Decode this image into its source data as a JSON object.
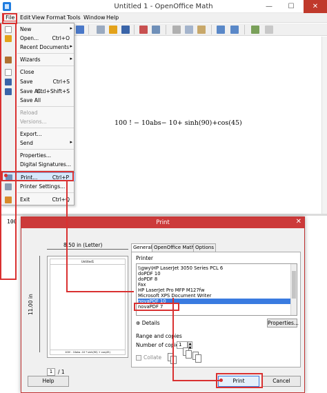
{
  "window": {
    "title": "Untitled 1 - OpenOffice Math",
    "minimize": "—",
    "maximize": "☐",
    "close": "✕"
  },
  "menubar": {
    "items": [
      "File",
      "Edit",
      "View",
      "Format",
      "Tools",
      "Window",
      "Help"
    ]
  },
  "file_menu": {
    "items": [
      {
        "label": "New",
        "shortcut": "",
        "submenu": true
      },
      {
        "label": "Open...",
        "shortcut": "Ctrl+O"
      },
      {
        "label": "Recent Documents",
        "shortcut": "",
        "submenu": true
      },
      {
        "label": "Wizards",
        "shortcut": "",
        "submenu": true
      },
      {
        "label": "Close",
        "shortcut": ""
      },
      {
        "label": "Save",
        "shortcut": "Ctrl+S"
      },
      {
        "label": "Save As...",
        "shortcut": "Ctrl+Shift+S"
      },
      {
        "label": "Save All",
        "shortcut": ""
      },
      {
        "label": "Reload",
        "shortcut": "",
        "disabled": true
      },
      {
        "label": "Versions...",
        "shortcut": "",
        "disabled": true
      },
      {
        "label": "Export...",
        "shortcut": ""
      },
      {
        "label": "Send",
        "shortcut": "",
        "submenu": true
      },
      {
        "label": "Properties...",
        "shortcut": ""
      },
      {
        "label": "Digital Signatures...",
        "shortcut": ""
      },
      {
        "label": "Print...",
        "shortcut": "Ctrl+P",
        "highlight": true
      },
      {
        "label": "Printer Settings...",
        "shortcut": ""
      },
      {
        "label": "Exit",
        "shortcut": "Ctrl+Q"
      }
    ],
    "submenu_arrow": "▸"
  },
  "document": {
    "formula": "100 ! − 10abs− 10+ sinh(90)+cos(45)",
    "command": "100"
  },
  "print_dialog": {
    "title": "Print",
    "close": "✕",
    "paper_size": "8.50 in (Letter)",
    "paper_height": "11.00 in",
    "preview_header": "Untitled1",
    "preview_footer": "100! - 10abs -10 * sinh(90) + cos(45)",
    "page_number": "1",
    "page_total": "/ 1",
    "tabs": [
      "General",
      "OpenOffice Math",
      "Options"
    ],
    "printer_label": "Printer",
    "printers": [
      "\\\\gwy\\HP LaserJet 3050 Series PCL 6",
      "doPDF 10",
      "doPDF 8",
      "Fax",
      "HP LaserJet Pro MFP M127fw",
      "Microsoft XPS Document Writer",
      "novaPDF 10",
      "novaPDF 7"
    ],
    "selected_printer_index": 6,
    "details_label": "Details",
    "details_toggle": "⊕",
    "properties_label": "Properties...",
    "range_label": "Range and copies",
    "copies_label": "Number of copies",
    "copies_value": "1",
    "collate_label": "Collate",
    "help_label": "Help",
    "print_label": "Print",
    "cancel_label": "Cancel"
  },
  "colors": {
    "annotation_red": "#d93030",
    "dialog_title": "#cc3a3a",
    "selection_blue": "#3a7be0"
  }
}
